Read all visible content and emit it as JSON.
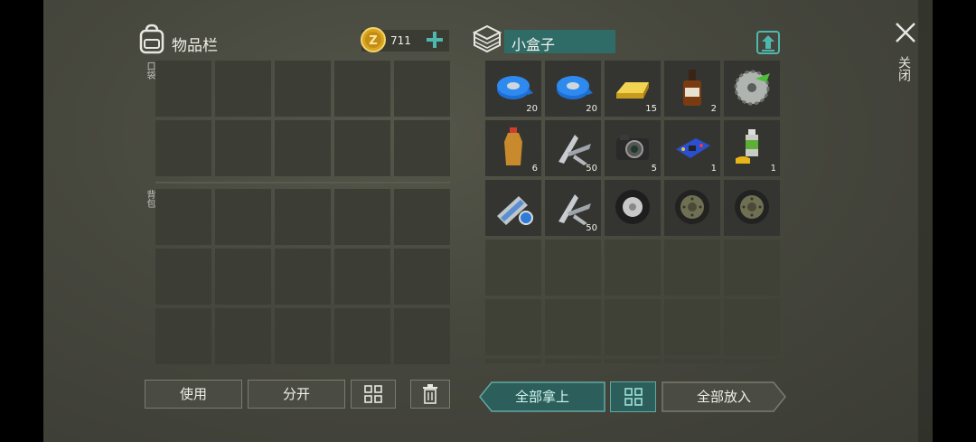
{
  "inventory": {
    "title": "物品栏",
    "pocket_label": "口袋",
    "backpack_label": "背包",
    "pocket_rows": 2,
    "backpack_rows": 3
  },
  "currency": {
    "icon": "gold-coin-icon",
    "amount": "711",
    "add_icon": "plus-icon"
  },
  "container": {
    "icon": "box-icon",
    "name": "小盒子",
    "upload_icon": "upload-icon",
    "items": [
      {
        "name": "blue-tape",
        "qty": "20"
      },
      {
        "name": "blue-tape",
        "qty": "20"
      },
      {
        "name": "gold-bar",
        "qty": "15"
      },
      {
        "name": "whiskey-bottle",
        "qty": "2"
      },
      {
        "name": "saw-blade",
        "qty": ""
      },
      {
        "name": "soda-bottle",
        "qty": "6"
      },
      {
        "name": "metal-parts",
        "qty": "50"
      },
      {
        "name": "camera",
        "qty": "5"
      },
      {
        "name": "circuit-board",
        "qty": "1"
      },
      {
        "name": "spray-can",
        "qty": "1"
      },
      {
        "name": "aluminum-can",
        "qty": ""
      },
      {
        "name": "metal-parts",
        "qty": "50"
      },
      {
        "name": "tire",
        "qty": ""
      },
      {
        "name": "wheel",
        "qty": ""
      },
      {
        "name": "wheel",
        "qty": ""
      }
    ]
  },
  "close": {
    "icon": "close-icon",
    "label": "关闭"
  },
  "buttons": {
    "use": "使用",
    "split": "分开",
    "sort_icon": "grid-sort-icon",
    "trash_icon": "trash-icon",
    "take_all": "全部拿上",
    "put_all": "全部放入"
  },
  "colors": {
    "accent_teal": "#2f6b67",
    "background": "#46473d",
    "slot": "#383930"
  }
}
